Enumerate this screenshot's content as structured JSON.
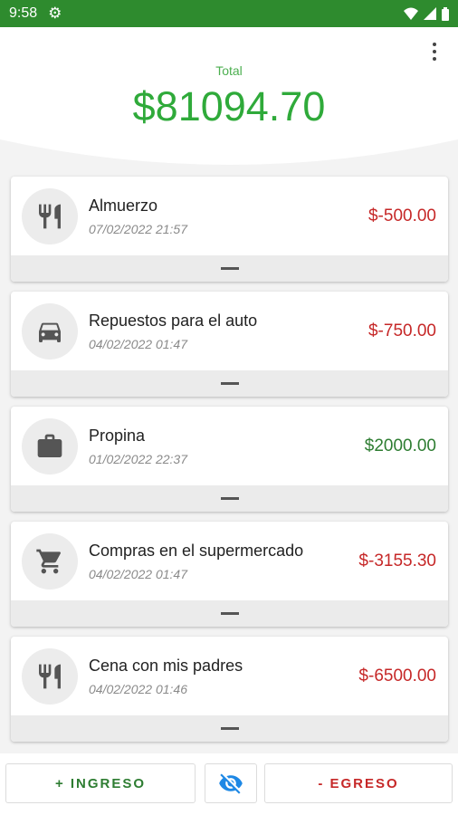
{
  "status_bar": {
    "time": "9:58"
  },
  "header": {
    "total_label": "Total",
    "total_amount": "$81094.70"
  },
  "transactions": [
    {
      "title": "Almuerzo",
      "date": "07/02/2022 21:57",
      "amount": "$-500.00",
      "type": "expense",
      "icon": "restaurant-icon"
    },
    {
      "title": "Repuestos para el auto",
      "date": "04/02/2022 01:47",
      "amount": "$-750.00",
      "type": "expense",
      "icon": "car-icon"
    },
    {
      "title": "Propina",
      "date": "01/02/2022 22:37",
      "amount": "$2000.00",
      "type": "income",
      "icon": "briefcase-icon"
    },
    {
      "title": "Compras en el supermercado",
      "date": "04/02/2022 01:47",
      "amount": "$-3155.30",
      "type": "expense",
      "icon": "cart-icon"
    },
    {
      "title": "Cena con mis padres",
      "date": "04/02/2022 01:46",
      "amount": "$-6500.00",
      "type": "expense",
      "icon": "restaurant-icon"
    }
  ],
  "actions": {
    "ingreso_label": "+ INGRESO",
    "egreso_label": "- EGRESO",
    "visibility_icon": "eye-off-icon"
  },
  "colors": {
    "status_bar": "#2e8b2e",
    "total": "#2faa3a",
    "expense": "#c62828",
    "income": "#2e7d32",
    "eye_icon": "#1e88e5"
  }
}
